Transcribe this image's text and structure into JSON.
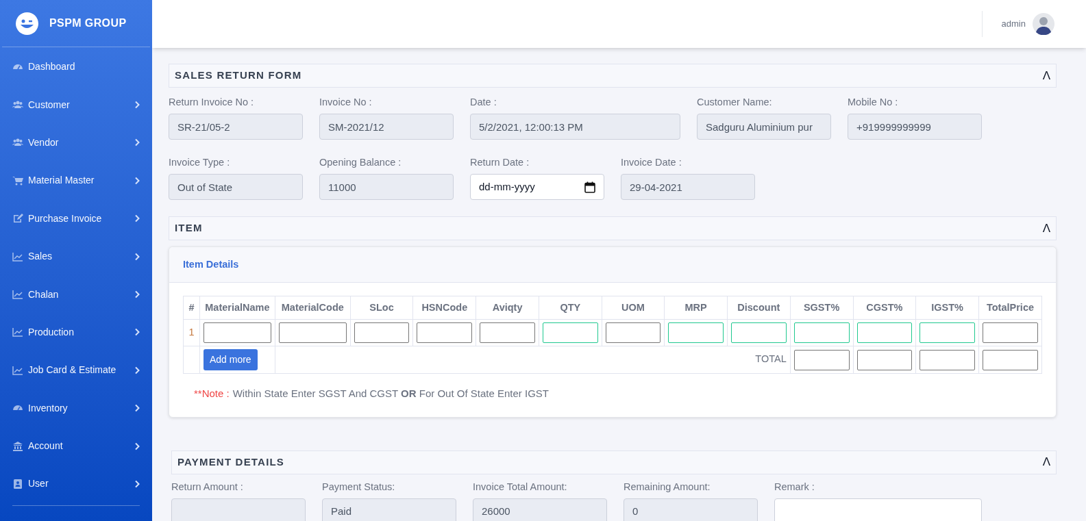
{
  "sidebar": {
    "brand": "PSPM GROUP",
    "items": [
      {
        "label": "Dashboard",
        "has_submenu": false
      },
      {
        "label": "Customer",
        "has_submenu": true
      },
      {
        "label": "Vendor",
        "has_submenu": true
      },
      {
        "label": "Material Master",
        "has_submenu": true
      },
      {
        "label": "Purchase Invoice",
        "has_submenu": true
      },
      {
        "label": "Sales",
        "has_submenu": true
      },
      {
        "label": "Chalan",
        "has_submenu": true
      },
      {
        "label": "Production",
        "has_submenu": true
      },
      {
        "label": "Job Card & Estimate",
        "has_submenu": true
      },
      {
        "label": "Inventory",
        "has_submenu": true
      },
      {
        "label": "Account",
        "has_submenu": true
      },
      {
        "label": "User",
        "has_submenu": true
      }
    ]
  },
  "header": {
    "user": "admin"
  },
  "return_form": {
    "title": "SALES RETURN FORM",
    "toggle": "Λ",
    "rows": [
      [
        {
          "label": "Return Invoice No :",
          "value": "SR-21/05-2",
          "kind": "readonly"
        },
        {
          "label": "Invoice No :",
          "value": "SM-2021/12",
          "kind": "readonly"
        },
        {
          "label": "Date :",
          "value": "5/2/2021, 12:00:13 PM",
          "kind": "readonly"
        },
        {
          "label": "Customer Name:",
          "value": "Sadguru Aluminium pur",
          "kind": "readonly"
        },
        {
          "label": "Mobile No :",
          "value": "+919999999999",
          "kind": "readonly"
        }
      ],
      [
        {
          "label": "Invoice Type :",
          "value": "Out of State",
          "kind": "readonly"
        },
        {
          "label": "Opening Balance :",
          "value": "11000",
          "kind": "readonly"
        },
        {
          "label": "Return Date :",
          "placeholder": "dd-mm-yyyy",
          "kind": "date"
        },
        {
          "label": "Invoice Date :",
          "value": "29-04-2021",
          "kind": "readonly"
        }
      ]
    ]
  },
  "item_section": {
    "title": "ITEM",
    "toggle": "Λ",
    "card_title": "Item Details",
    "columns": [
      "#",
      "MaterialName",
      "MaterialCode",
      "SLoc",
      "HSNCode",
      "Aviqty",
      "QTY",
      "UOM",
      "MRP",
      "Discount",
      "SGST%",
      "CGST%",
      "IGST%",
      "TotalPrice"
    ],
    "rows": [
      {
        "number": "1",
        "inputs": [
          {
            "highlighted": false
          },
          {
            "highlighted": false
          },
          {
            "highlighted": false
          },
          {
            "highlighted": false
          },
          {
            "highlighted": false
          },
          {
            "highlighted": true
          },
          {
            "highlighted": false
          },
          {
            "highlighted": true
          },
          {
            "highlighted": true
          },
          {
            "highlighted": true
          },
          {
            "highlighted": true
          },
          {
            "highlighted": true
          },
          {
            "highlighted": false
          }
        ]
      }
    ],
    "add_button": "Add more",
    "total_label": "TOTAL",
    "total_inputs": [
      {
        "highlighted": false
      },
      {
        "highlighted": false
      },
      {
        "highlighted": false
      },
      {
        "highlighted": false
      }
    ],
    "note_prefix": "**Note :",
    "note_text": "Within State Enter SGST And CGST **OR** For Out Of State Enter IGST"
  },
  "payment": {
    "title": "PAYMENT DETAILS",
    "toggle": "Λ",
    "fields": [
      {
        "label": "Return Amount :",
        "kind": "readonly"
      },
      {
        "label": "Payment Status:",
        "value": "Paid",
        "kind": "readonly"
      },
      {
        "label": "Invoice Total Amount:",
        "value": "26000",
        "kind": "readonly"
      },
      {
        "label": "Remaining Amount:",
        "value": "0",
        "kind": "readonly"
      },
      {
        "label": "Remark :",
        "kind": "textarea"
      }
    ]
  }
}
